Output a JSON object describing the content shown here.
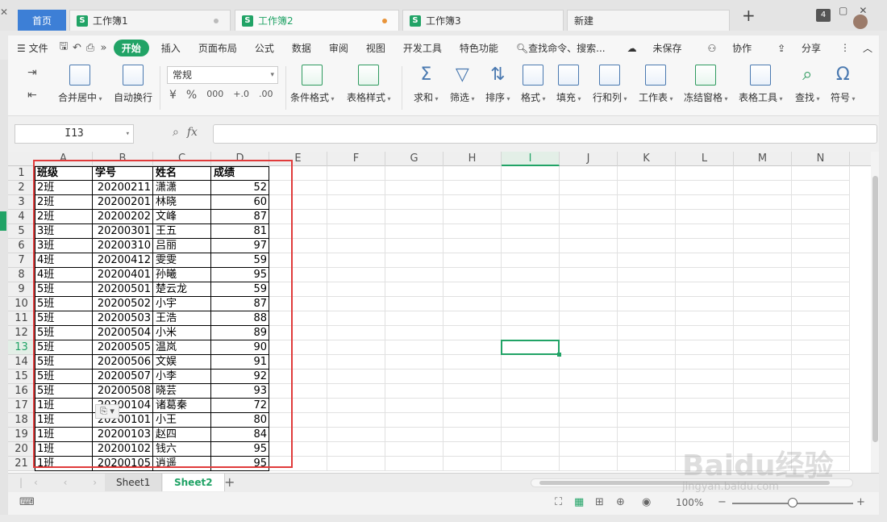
{
  "tabs": {
    "home": "首页",
    "book1": "工作簿1",
    "book2": "工作簿2",
    "book3": "工作簿3",
    "new": "新建",
    "count": "4",
    "sicon": "S"
  },
  "menu": {
    "file": "文件",
    "start": "开始",
    "insert": "插入",
    "layout": "页面布局",
    "formula": "公式",
    "data": "数据",
    "review": "审阅",
    "view": "视图",
    "dev": "开发工具",
    "special": "特色功能",
    "search": "查找命令、搜索...",
    "unsaved": "未保存",
    "collab": "协作",
    "share": "分享"
  },
  "ribbon": {
    "merge": "合并居中",
    "wrap": "自动换行",
    "format_value": "常规",
    "percent": "%",
    "thousands": "000",
    "dec_inc": "+.0",
    "dec_dec": ".00",
    "cond_format": "条件格式",
    "table_style": "表格样式",
    "sum": "求和",
    "filter": "筛选",
    "sort": "排序",
    "format": "格式",
    "fill": "填充",
    "rowcol": "行和列",
    "sheet": "工作表",
    "freeze": "冻结窗格",
    "table_tools": "表格工具",
    "find": "查找",
    "symbol": "符号"
  },
  "formula_bar": {
    "name_box": "I13",
    "fx": "fx",
    "value": ""
  },
  "columns": [
    "A",
    "B",
    "C",
    "D",
    "E",
    "F",
    "G",
    "H",
    "I",
    "J",
    "K",
    "L",
    "M",
    "N"
  ],
  "selected_column": "I",
  "selected_row": 13,
  "table": {
    "headers": [
      "班级",
      "学号",
      "姓名",
      "成绩"
    ],
    "rows": [
      [
        "2班",
        "20200211",
        "潇潇",
        "52"
      ],
      [
        "2班",
        "20200201",
        "林晓",
        "60"
      ],
      [
        "2班",
        "20200202",
        "文峰",
        "87"
      ],
      [
        "3班",
        "20200301",
        "王五",
        "81"
      ],
      [
        "3班",
        "20200310",
        "吕丽",
        "97"
      ],
      [
        "4班",
        "20200412",
        "雯雯",
        "59"
      ],
      [
        "4班",
        "20200401",
        "孙曦",
        "95"
      ],
      [
        "5班",
        "20200501",
        "楚云龙",
        "59"
      ],
      [
        "5班",
        "20200502",
        "小宇",
        "87"
      ],
      [
        "5班",
        "20200503",
        "王浩",
        "88"
      ],
      [
        "5班",
        "20200504",
        "小米",
        "89"
      ],
      [
        "5班",
        "20200505",
        "温岚",
        "90"
      ],
      [
        "5班",
        "20200506",
        "文娱",
        "91"
      ],
      [
        "5班",
        "20200507",
        "小李",
        "92"
      ],
      [
        "5班",
        "20200508",
        "晓芸",
        "93"
      ],
      [
        "1班",
        "20200104",
        "诸葛秦",
        "72"
      ],
      [
        "1班",
        "20200101",
        "小王",
        "80"
      ],
      [
        "1班",
        "20200103",
        "赵四",
        "84"
      ],
      [
        "1班",
        "20200102",
        "钱六",
        "95"
      ],
      [
        "1班",
        "20200105",
        "逍遥",
        "95"
      ]
    ]
  },
  "sheets": [
    "Sheet1",
    "Sheet2"
  ],
  "active_sheet": "Sheet2",
  "status": {
    "zoom": "100%"
  },
  "watermark": {
    "main": "Baidu经验",
    "sub": "jingyan.baidu.com"
  },
  "colors": {
    "accent": "#21a366",
    "home_tab": "#3d7fd6",
    "highlight_box": "#e03b3b"
  }
}
